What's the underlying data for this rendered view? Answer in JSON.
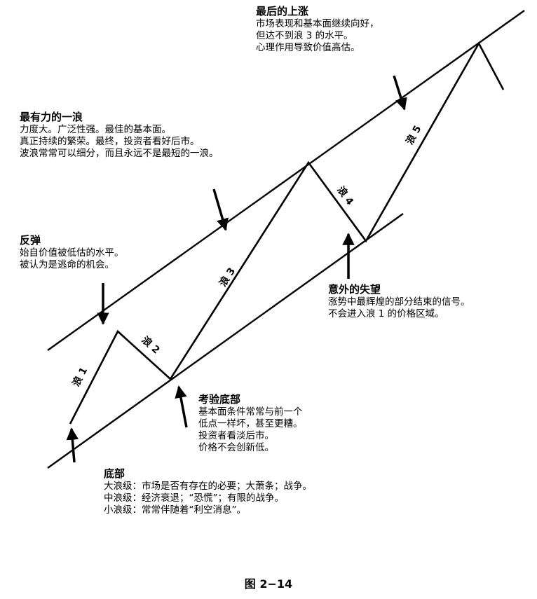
{
  "annotations": {
    "final_rise": {
      "title": "最后的上涨",
      "lines": [
        "市场表现和基本面继续向好，",
        "但达不到浪 3 的水平。",
        "心理作用导致价值高估。"
      ]
    },
    "strongest_wave": {
      "title": "最有力的一浪",
      "lines": [
        "力度大。广泛性强。最佳的基本面。",
        "真正持续的繁荣。最终，投资者看好后市。",
        "波浪常常可以细分，而且永远不是最短的一浪。"
      ]
    },
    "rebound": {
      "title": "反弹",
      "lines": [
        "始自价值被低估的水平。",
        "被认为是逃命的机会。"
      ]
    },
    "disappointment": {
      "title": "意外的失望",
      "lines": [
        "涨势中最辉煌的部分结束的信号。",
        "不会进入浪 1 的价格区域。"
      ]
    },
    "test_bottom": {
      "title": "考验底部",
      "lines": [
        "基本面条件常常与前一个",
        "低点一样坏，甚至更糟。",
        "投资者看淡后市。",
        "价格不会创新低。"
      ]
    },
    "bottom": {
      "title": "底部",
      "lines": [
        "大浪级：市场是否有存在的必要；大萧条；战争。",
        "中浪级：经济衰退；“恐慌”；有限的战争。",
        "小浪级：常常伴随着“利空消息”。"
      ]
    }
  },
  "waves": [
    {
      "id": "wave-1",
      "label": "浪 1"
    },
    {
      "id": "wave-2",
      "label": "浪 2"
    },
    {
      "id": "wave-3",
      "label": "浪 3"
    },
    {
      "id": "wave-4",
      "label": "浪 4"
    },
    {
      "id": "wave-5",
      "label": "浪 5"
    }
  ],
  "caption": "图 2−14"
}
